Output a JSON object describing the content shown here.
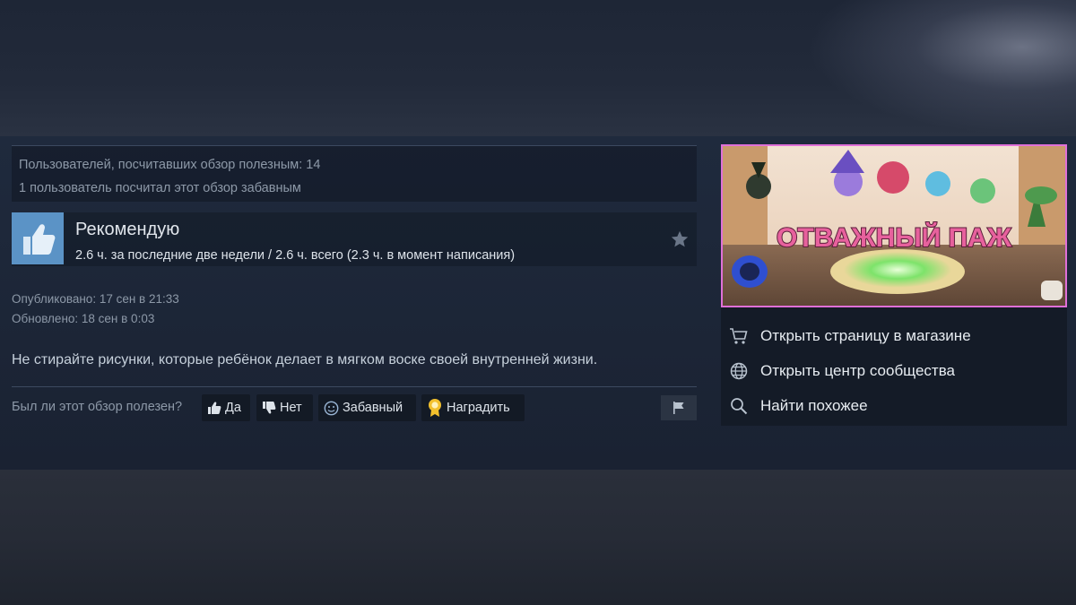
{
  "stats": {
    "helpful_line": "Пользователей, посчитавших обзор полезным: 14",
    "funny_line": "1 пользователь посчитал этот обзор забавным"
  },
  "review": {
    "verdict": "Рекомендую",
    "hours": "2.6 ч. за последние две недели / 2.6 ч. всего (2.3 ч. в момент написания)",
    "posted": "Опубликовано: 17 сен в 21:33",
    "updated": "Обновлено: 18 сен в 0:03",
    "text": "Не стирайте рисунки, которые ребёнок делает в мягком воске своей внутренней жизни.",
    "thumb_icon": "thumbs-up-icon",
    "star_icon": "star-icon"
  },
  "helpful": {
    "question": "Был ли этот обзор полезен?",
    "yes_label": "Да",
    "no_label": "Нет",
    "funny_label": "Забавный",
    "award_label": "Наградить",
    "flag_icon": "flag-icon"
  },
  "game": {
    "capsule_title": "ОТВАЖНЫЙ ПАЖ",
    "links": [
      {
        "label": "Открыть страницу в магазине",
        "icon": "cart-icon"
      },
      {
        "label": "Открыть центр сообщества",
        "icon": "globe-icon"
      },
      {
        "label": "Найти похожее",
        "icon": "search-icon"
      }
    ]
  },
  "colors": {
    "accent_blue": "#5b93c6",
    "capsule_border": "#e070d8",
    "award_gold": "#f2c02d",
    "title_pink": "#e7619d"
  }
}
